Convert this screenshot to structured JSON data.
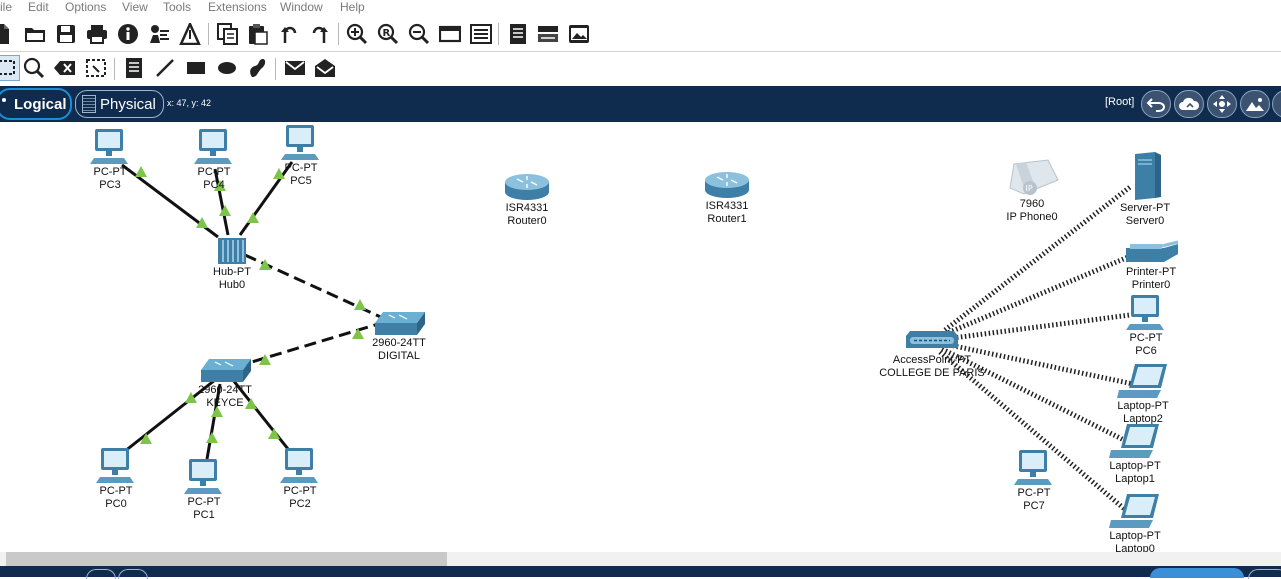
{
  "menu": [
    "ile",
    "Edit",
    "Options",
    "View",
    "Tools",
    "Extensions",
    "Window",
    "Help"
  ],
  "toolbar_main": [
    "new-file-icon",
    "open-folder-icon",
    "save-icon",
    "print-icon",
    "info-icon",
    "activity-wizard-icon",
    "pdu-icon",
    "copy-icon",
    "paste-icon",
    "undo-icon",
    "redo-icon",
    "zoom-in-icon",
    "zoom-reset-icon",
    "zoom-out-icon",
    "window-icon",
    "palette-icon",
    "notes-icon",
    "device-icon",
    "image-icon"
  ],
  "toolbar_draw": [
    "select-icon",
    "inspect-icon",
    "delete-icon",
    "resize-icon",
    "note-icon",
    "line-icon",
    "rectangle-icon",
    "ellipse-icon",
    "freeform-icon",
    "simple-pdu-icon",
    "complex-pdu-icon"
  ],
  "nav": {
    "logical": "Logical",
    "physical": "Physical",
    "coords": "x: 47, y: 42",
    "root": "[Root]"
  },
  "colors": {
    "navbar": "#0f2b4e",
    "link": "#111111",
    "link_light": "#7cc44a",
    "device": "#3d7fa6"
  },
  "devices": [
    {
      "id": "pc3",
      "type": "pc",
      "model": "PC-PT",
      "name": "PC3"
    },
    {
      "id": "pc4",
      "type": "pc",
      "model": "PC-PT",
      "name": "PC4"
    },
    {
      "id": "pc5",
      "type": "pc",
      "model": "PC-PT",
      "name": "PC5"
    },
    {
      "id": "hub0",
      "type": "hub",
      "model": "Hub-PT",
      "name": "Hub0"
    },
    {
      "id": "digital",
      "type": "switch",
      "model": "2960-24TT",
      "name": "DIGITAL"
    },
    {
      "id": "keyce",
      "type": "switch",
      "model": "2960-24TT",
      "name": "KEYCE"
    },
    {
      "id": "pc0",
      "type": "pc",
      "model": "PC-PT",
      "name": "PC0"
    },
    {
      "id": "pc1",
      "type": "pc",
      "model": "PC-PT",
      "name": "PC1"
    },
    {
      "id": "pc2",
      "type": "pc",
      "model": "PC-PT",
      "name": "PC2"
    },
    {
      "id": "router0",
      "type": "router",
      "model": "ISR4331",
      "name": "Router0"
    },
    {
      "id": "router1",
      "type": "router",
      "model": "ISR4331",
      "name": "Router1"
    },
    {
      "id": "phone0",
      "type": "phone",
      "model": "7960",
      "name": "IP Phone0"
    },
    {
      "id": "ap",
      "type": "ap",
      "model": "AccessPoint-PT",
      "name": "COLLEGE DE PARIS"
    },
    {
      "id": "server0",
      "type": "server",
      "model": "Server-PT",
      "name": "Server0"
    },
    {
      "id": "printer0",
      "type": "printer",
      "model": "Printer-PT",
      "name": "Printer0"
    },
    {
      "id": "pc6",
      "type": "pc",
      "model": "PC-PT",
      "name": "PC6"
    },
    {
      "id": "laptop2",
      "type": "laptop",
      "model": "Laptop-PT",
      "name": "Laptop2"
    },
    {
      "id": "laptop1",
      "type": "laptop",
      "model": "Laptop-PT",
      "name": "Laptop1"
    },
    {
      "id": "pc7",
      "type": "pc",
      "model": "PC-PT",
      "name": "PC7"
    },
    {
      "id": "laptop0",
      "type": "laptop",
      "model": "Laptop-PT",
      "name": "Laptop0"
    }
  ],
  "links": [
    {
      "from": "pc3",
      "to": "hub0",
      "style": "solid"
    },
    {
      "from": "pc4",
      "to": "hub0",
      "style": "solid"
    },
    {
      "from": "pc5",
      "to": "hub0",
      "style": "solid"
    },
    {
      "from": "hub0",
      "to": "digital",
      "style": "dashed"
    },
    {
      "from": "digital",
      "to": "keyce",
      "style": "dashed"
    },
    {
      "from": "keyce",
      "to": "pc0",
      "style": "solid"
    },
    {
      "from": "keyce",
      "to": "pc1",
      "style": "solid"
    },
    {
      "from": "keyce",
      "to": "pc2",
      "style": "solid"
    },
    {
      "from": "ap",
      "to": "server0",
      "style": "wireless"
    },
    {
      "from": "ap",
      "to": "printer0",
      "style": "wireless"
    },
    {
      "from": "ap",
      "to": "pc6",
      "style": "wireless"
    },
    {
      "from": "ap",
      "to": "laptop2",
      "style": "wireless"
    },
    {
      "from": "ap",
      "to": "laptop1",
      "style": "wireless"
    },
    {
      "from": "ap",
      "to": "laptop0",
      "style": "wireless"
    }
  ]
}
